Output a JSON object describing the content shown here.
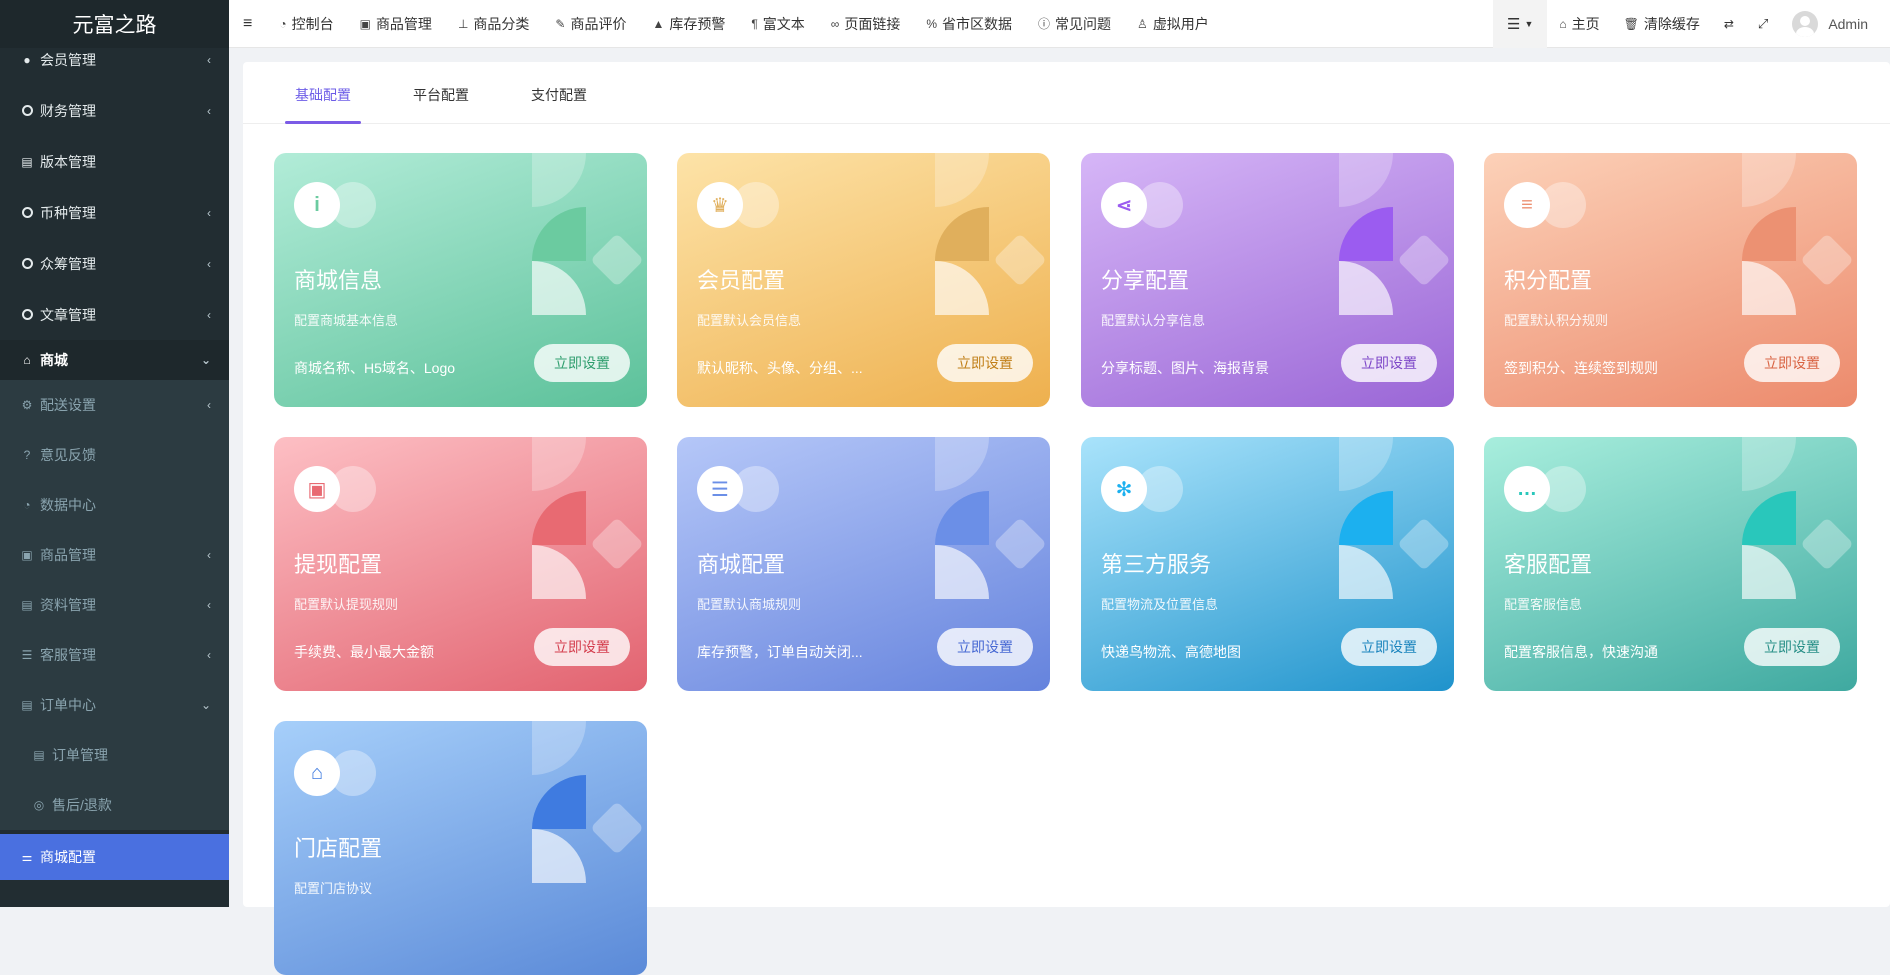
{
  "brand": "元富之路",
  "sidebar": {
    "items": [
      {
        "label": "会员管理",
        "icon": "user-circle-icon",
        "arrow": "‹"
      },
      {
        "label": "财务管理",
        "icon": "circle-icon",
        "arrow": "‹"
      },
      {
        "label": "版本管理",
        "icon": "file-icon",
        "arrow": ""
      },
      {
        "label": "币种管理",
        "icon": "circle-icon",
        "arrow": "‹"
      },
      {
        "label": "众筹管理",
        "icon": "circle-icon",
        "arrow": "‹"
      },
      {
        "label": "文章管理",
        "icon": "circle-icon",
        "arrow": "‹"
      },
      {
        "label": "商城",
        "icon": "home-icon",
        "arrow": "⌄"
      }
    ],
    "sub_items": [
      {
        "label": "配送设置",
        "icon": "gears-icon",
        "arrow": "‹"
      },
      {
        "label": "意见反馈",
        "icon": "question-icon",
        "arrow": ""
      },
      {
        "label": "数据中心",
        "icon": "dashboard-icon",
        "arrow": ""
      },
      {
        "label": "商品管理",
        "icon": "archive-icon",
        "arrow": "‹"
      },
      {
        "label": "资料管理",
        "icon": "file-text-icon",
        "arrow": "‹"
      },
      {
        "label": "客服管理",
        "icon": "list-icon",
        "arrow": "‹"
      },
      {
        "label": "订单中心",
        "icon": "file-icon",
        "arrow": "⌄"
      }
    ],
    "deep_items": [
      {
        "label": "订单管理",
        "icon": "file-text-icon"
      },
      {
        "label": "售后/退款",
        "icon": "eye-icon"
      }
    ],
    "selected": {
      "label": "商城配置",
      "icon": "sliders-icon"
    }
  },
  "topnav": [
    {
      "label": "控制台",
      "icon": "dashboard-icon"
    },
    {
      "label": "商品管理",
      "icon": "archive-icon"
    },
    {
      "label": "商品分类",
      "icon": "sitemap-icon"
    },
    {
      "label": "商品评价",
      "icon": "edit-icon"
    },
    {
      "label": "库存预警",
      "icon": "warning-icon"
    },
    {
      "label": "富文本",
      "icon": "rich-text-icon"
    },
    {
      "label": "页面链接",
      "icon": "link-icon"
    },
    {
      "label": "省市区数据",
      "icon": "percent-icon"
    },
    {
      "label": "常见问题",
      "icon": "info-icon"
    },
    {
      "label": "虚拟用户",
      "icon": "user-icon"
    }
  ],
  "topright": {
    "home": "主页",
    "clear_cache": "清除缓存",
    "user": "Admin"
  },
  "tabs": [
    "基础配置",
    "平台配置",
    "支付配置"
  ],
  "cards": [
    {
      "title": "商城信息",
      "desc": "配置商城基本信息",
      "foot": "商城名称、H5域名、Logo",
      "btn": "立即设置",
      "icon": "info-icon",
      "glyph": "i",
      "from": "#b2ecd8",
      "to": "#5cc19a",
      "accent": "#6bcba0",
      "btn_color": "#2f9e6e"
    },
    {
      "title": "会员配置",
      "desc": "配置默认会员信息",
      "foot": "默认昵称、头像、分组、...",
      "btn": "立即设置",
      "icon": "crown-icon",
      "glyph": "♛",
      "from": "#fde3a8",
      "to": "#eeb04e",
      "accent": "#e0af5c",
      "btn_color": "#c17f17"
    },
    {
      "title": "分享配置",
      "desc": "配置默认分享信息",
      "foot": "分享标题、图片、海报背景",
      "btn": "立即设置",
      "icon": "share-icon",
      "glyph": "⋖",
      "from": "#d6b6f7",
      "to": "#9a66d6",
      "accent": "#9b5cf0",
      "btn_color": "#7d47c8"
    },
    {
      "title": "积分配置",
      "desc": "配置默认积分规则",
      "foot": "签到积分、连续签到规则",
      "btn": "立即设置",
      "icon": "coins-icon",
      "glyph": "≡",
      "from": "#fcd1b8",
      "to": "#ec8a6c",
      "accent": "#ec9172",
      "btn_color": "#d96443"
    },
    {
      "title": "提现配置",
      "desc": "配置默认提现规则",
      "foot": "手续费、最小最大金额",
      "btn": "立即设置",
      "icon": "wallet-icon",
      "glyph": "▣",
      "from": "#fdbfc4",
      "to": "#e26370",
      "accent": "#e86a72",
      "btn_color": "#d43d4d"
    },
    {
      "title": "商城配置",
      "desc": "配置默认商城规则",
      "foot": "库存预警，订单自动关闭...",
      "btn": "立即设置",
      "icon": "clipboard-icon",
      "glyph": "☰",
      "from": "#b5c7f8",
      "to": "#6583dd",
      "accent": "#6b8fe7",
      "btn_color": "#4668d3"
    },
    {
      "title": "第三方服务",
      "desc": "配置物流及位置信息",
      "foot": "快递鸟物流、高德地图",
      "btn": "立即设置",
      "icon": "atom-icon",
      "glyph": "✻",
      "from": "#a9e3fb",
      "to": "#1f93cc",
      "accent": "#1cb0ef",
      "btn_color": "#1a84bd"
    },
    {
      "title": "客服配置",
      "desc": "配置客服信息",
      "foot": "配置客服信息，快速沟通",
      "btn": "立即设置",
      "icon": "chat-icon",
      "glyph": "…",
      "from": "#a8eedd",
      "to": "#3fa9a0",
      "accent": "#29c7bb",
      "btn_color": "#278f87"
    },
    {
      "title": "门店配置",
      "desc": "配置门店协议",
      "foot": "",
      "btn": "",
      "icon": "store-icon",
      "glyph": "⌂",
      "from": "#a6cffa",
      "to": "#5b8ad8",
      "accent": "#3f7be0",
      "btn_color": "#3768c5"
    }
  ]
}
